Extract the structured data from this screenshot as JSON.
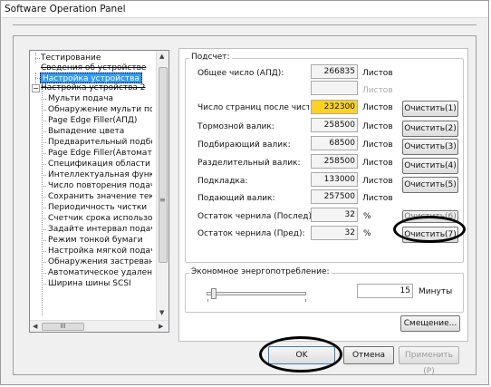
{
  "window": {
    "title": "Software Operation Panel"
  },
  "tree": {
    "items": [
      "Тестирование",
      "Сведения об устройстве",
      "Настройка устройства",
      "Настройка устройства 2",
      "Мульти подача",
      "Обнаружение мульти подачи",
      "Page Edge Filler(АПД)",
      "Выпадение цвета",
      "Предварительный подбор",
      "Page Edge Filler(Автоматически)",
      "Спецификация области сканирования",
      "Интеллектуальная функция",
      "Число повторения подачи",
      "Сохранить значение текущего",
      "Периодичность чистки",
      "Счетчик срока использования",
      "Задайте интервал подачи",
      "Режим тонкой бумаги",
      "Настройка мягкой подачи",
      "Обнаружения застревания",
      "Автоматическое удаление",
      "Ширина шины SCSI"
    ],
    "hscroll_thumb": "III"
  },
  "counters": {
    "group_title": "Подсчет:",
    "rows": [
      {
        "label": "Общее число (АПД):",
        "value": "266835",
        "unit": "Листов"
      },
      {
        "label": "",
        "value": "",
        "unit": "Листов"
      },
      {
        "label": "Число страниц после чистки:",
        "value": "232300",
        "unit": "Листов",
        "button": "Очистить(1)"
      },
      {
        "label": "Тормозной валик:",
        "value": "258500",
        "unit": "Листов",
        "button": "Очистить(2)"
      },
      {
        "label": "Подбирающий валик:",
        "value": "68500",
        "unit": "Листов",
        "button": "Очистить(3)"
      },
      {
        "label": "Разделительный валик:",
        "value": "258500",
        "unit": "Листов",
        "button": "Очистить(4)"
      },
      {
        "label": "Подкладка:",
        "value": "133000",
        "unit": "Листов",
        "button": "Очистить(5)"
      },
      {
        "label": "Подающий валик:",
        "value": "257500",
        "unit": "Листов"
      },
      {
        "label": "Остаток чернила (Послед):",
        "value": "32",
        "unit": "%",
        "button": "Очистить(6)"
      },
      {
        "label": "Остаток чернила (Пред):",
        "value": "32",
        "unit": "%",
        "button": "Очистить(7)"
      }
    ]
  },
  "energy": {
    "group_title": "Экономное энергопотребление:",
    "value": "15",
    "unit": "Минуты",
    "slider_level": 0.05
  },
  "buttons": {
    "offset": "Смещение...",
    "ok": "OK",
    "cancel": "Отмена",
    "apply": "Применить (P)"
  }
}
